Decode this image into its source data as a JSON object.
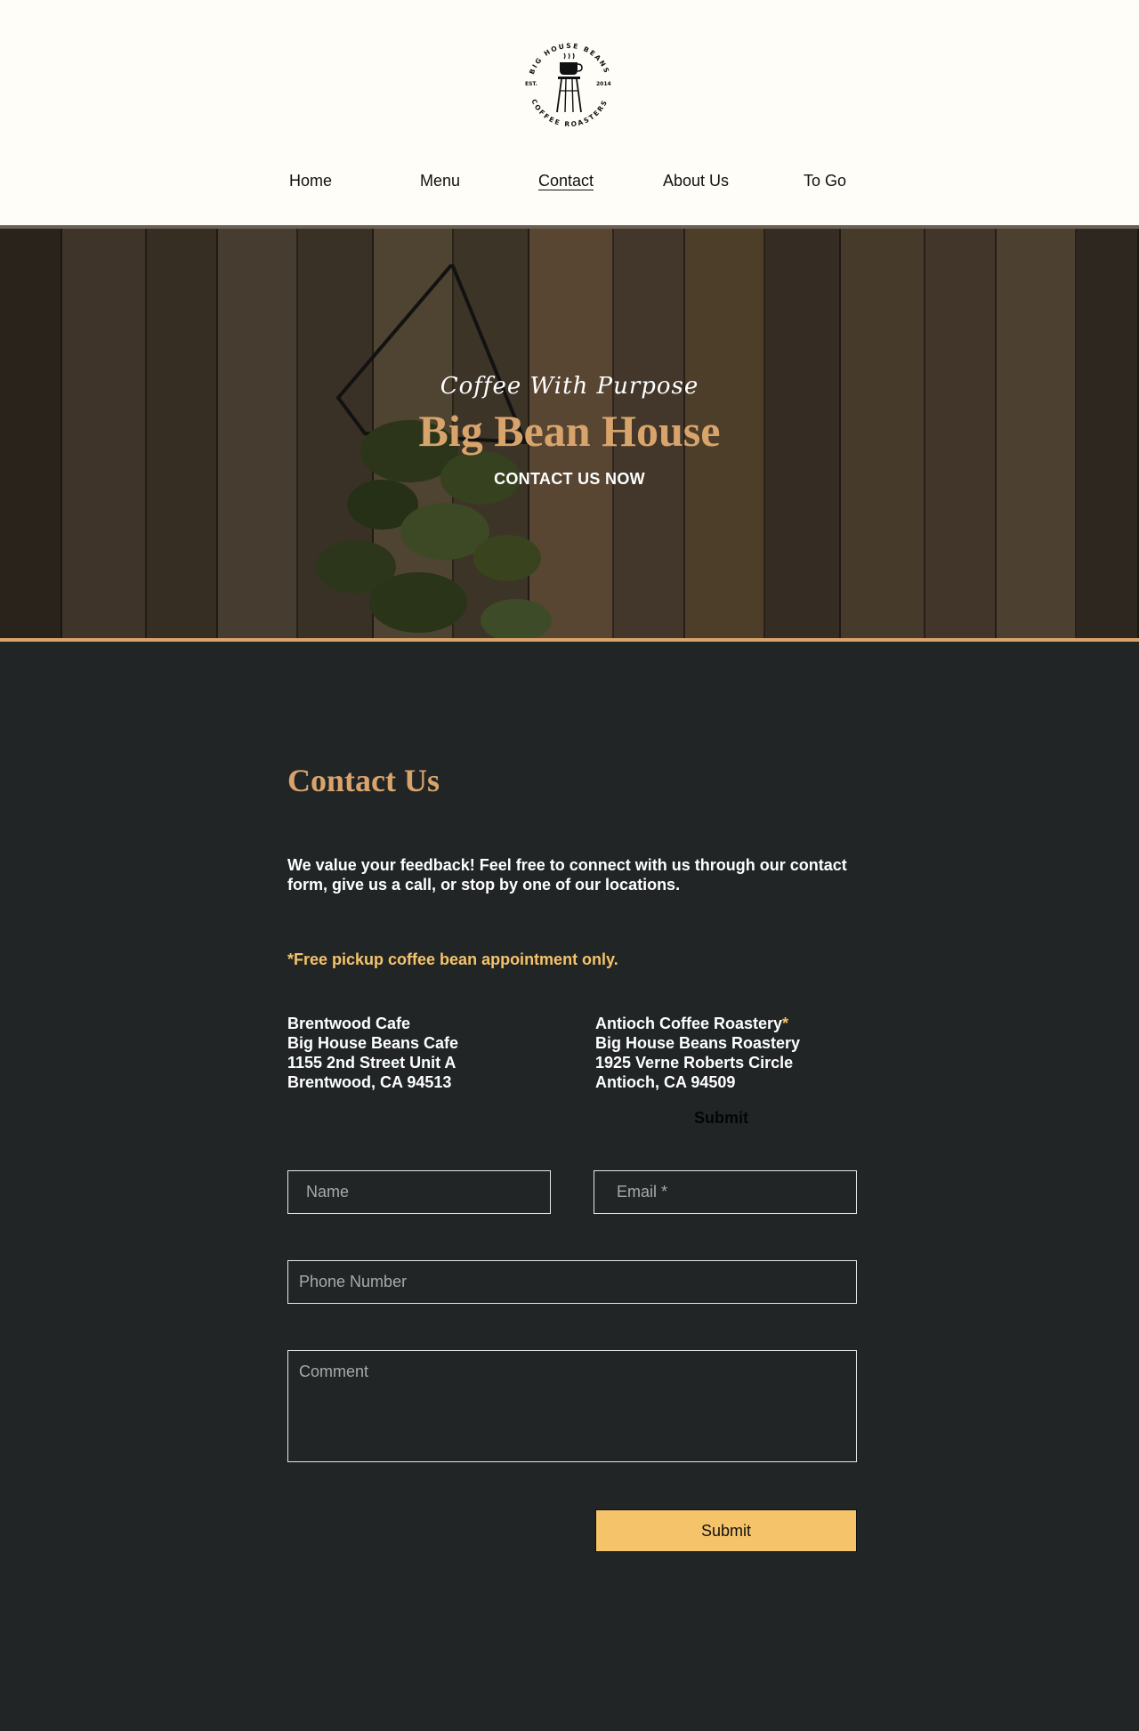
{
  "logo": {
    "top_arc": "BIG HOUSE BEANS",
    "bottom_arc": "COFFEE ROASTERS",
    "left_text": "EST.",
    "right_text": "2014"
  },
  "nav": {
    "items": [
      "Home",
      "Menu",
      "Contact",
      "About Us",
      "To Go"
    ],
    "active": "Contact"
  },
  "hero": {
    "tagline": "Coffee With Purpose",
    "title": "Big Bean House",
    "cta": "CONTACT US NOW"
  },
  "contact": {
    "title": "Contact Us",
    "intro": "We value your feedback! Feel free to connect with us through our contact form, give us a call, or stop by one of our locations.",
    "notice": "*Free pickup coffee bean appointment only.",
    "locations": [
      {
        "name": "Brentwood Cafe",
        "star": "",
        "business": "Big House Beans Cafe",
        "street": "1155 2nd Street Unit A",
        "city": "Brentwood, CA 94513"
      },
      {
        "name": "Antioch Coffee Roastery",
        "star": "*",
        "business": "Big House Beans Roastery",
        "street": "1925 Verne Roberts Circle",
        "city": "Antioch, CA 94509"
      }
    ],
    "ghost_submit": "Submit"
  },
  "form": {
    "name_placeholder": "Name",
    "email_placeholder": "Email *",
    "phone_placeholder": "Phone Number",
    "comment_placeholder": "Comment",
    "submit_label": "Submit"
  },
  "colors": {
    "accent_tan": "#d9a46c",
    "accent_yellow": "#f5c36a",
    "dark_bg": "#212526",
    "header_bg": "#fffdf8"
  }
}
